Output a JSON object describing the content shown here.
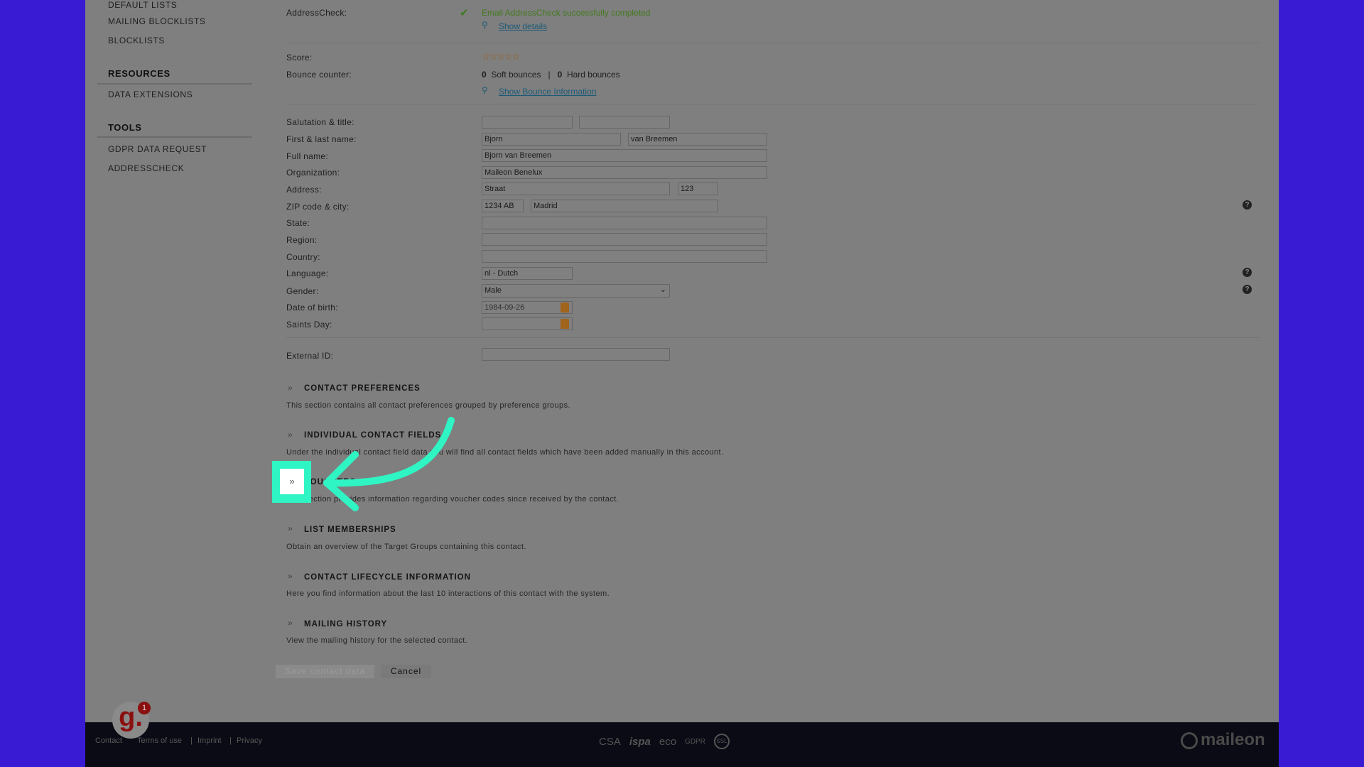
{
  "sidebar": {
    "items_top": [
      "DEFAULT LISTS",
      "MAILING BLOCKLISTS",
      "BLOCKLISTS"
    ],
    "resources_heading": "RESOURCES",
    "resources": [
      "DATA EXTENSIONS"
    ],
    "tools_heading": "TOOLS",
    "tools": [
      "GDPR DATA REQUEST",
      "ADDRESSCHECK"
    ]
  },
  "addresscheck": {
    "label": "AddressCheck:",
    "status": "Email AddressCheck successfully completed",
    "show_details": "Show details"
  },
  "score": {
    "label": "Score:",
    "stars": "☆☆☆☆☆",
    "value": 0
  },
  "bounce": {
    "label": "Bounce counter:",
    "soft_count": "0",
    "soft_label": "Soft bounces",
    "sep": "|",
    "hard_count": "0",
    "hard_label": "Hard bounces",
    "show_info": "Show Bounce Information"
  },
  "form": {
    "salutation_label": "Salutation & title:",
    "salutation": "",
    "title": "",
    "name_label": "First & last name:",
    "first_name": "Bjorn",
    "last_name": "van Breemen",
    "full_name_label": "Full name:",
    "full_name": "Bjorn van Breemen",
    "organization_label": "Organization:",
    "organization": "Maileon Benelux",
    "address_label": "Address:",
    "street": "Straat",
    "number": "123",
    "zip_label": "ZIP code & city:",
    "zip": "1234 AB",
    "city": "Madrid",
    "state_label": "State:",
    "state": "",
    "region_label": "Region:",
    "region": "",
    "country_label": "Country:",
    "country": "",
    "language_label": "Language:",
    "language": "nl - Dutch",
    "gender_label": "Gender:",
    "gender": "Male",
    "dob_label": "Date of birth:",
    "dob": "1984-09-26",
    "saints_label": "Saints Day:",
    "saints": "",
    "external_label": "External ID:",
    "external": ""
  },
  "sections": [
    {
      "title": "CONTACT PREFERENCES",
      "desc": "This section contains all contact preferences grouped by preference groups."
    },
    {
      "title": "INDIVIDUAL CONTACT FIELDS",
      "desc": "Under the individual contact field data you will find all contact fields which have been added manually in this account."
    },
    {
      "title": "VOUCHERS",
      "desc": "This section provides information regarding voucher codes since received by the contact."
    },
    {
      "title": "LIST MEMBERSHIPS",
      "desc": "Obtain an overview of the Target Groups containing this contact."
    },
    {
      "title": "CONTACT LIFECYCLE INFORMATION",
      "desc": "Here you find information about the last 10 interactions of this contact with the system."
    },
    {
      "title": "MAILING HISTORY",
      "desc": "View the mailing history for the selected contact."
    }
  ],
  "buttons": {
    "save": "Save contact data",
    "cancel": "Cancel"
  },
  "footer": {
    "links": [
      "Contact",
      "Terms of use",
      "Imprint",
      "Privacy"
    ],
    "seps": "|",
    "badges": [
      "CSA",
      "ispa",
      "eco",
      "GDPR",
      "SSL"
    ],
    "brand": "maileon"
  },
  "avatar": {
    "letter": "g.",
    "badge": "1"
  },
  "colors": {
    "accent_highlight": "#2ff5c4",
    "background": "#3a1bd4"
  }
}
